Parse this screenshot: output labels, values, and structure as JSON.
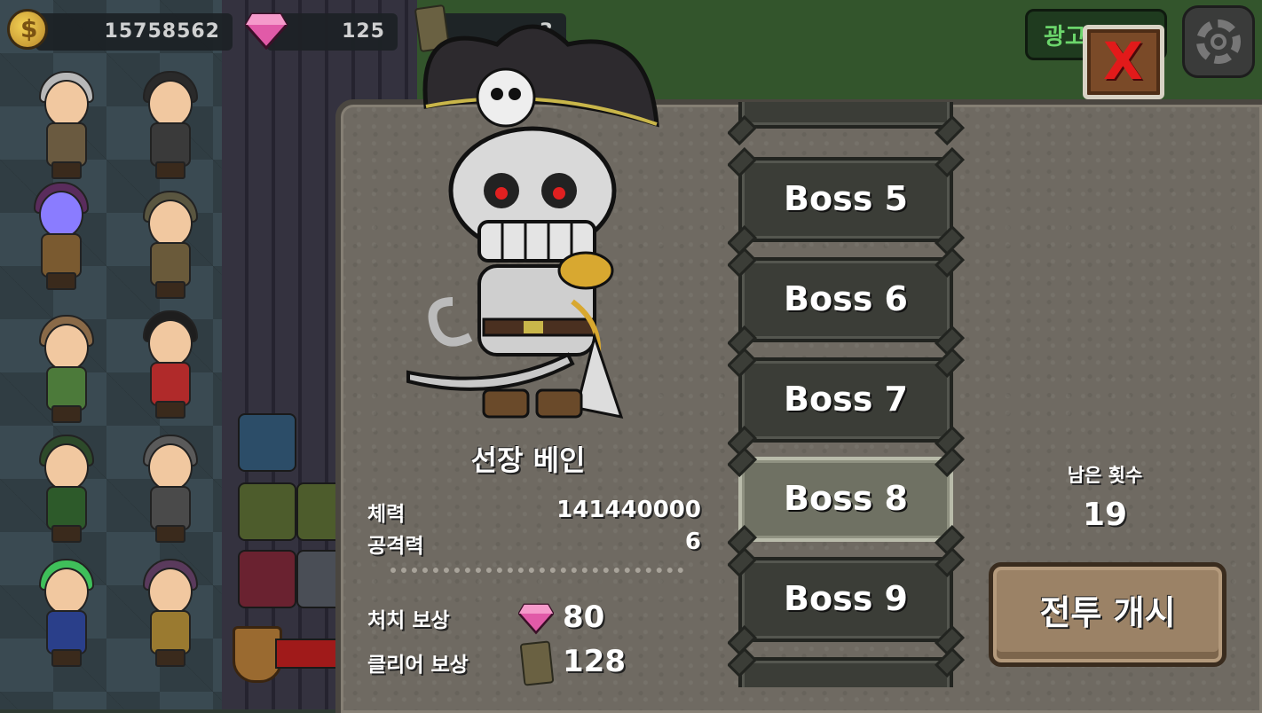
{
  "resources": {
    "gold": "15758562",
    "gems": "125",
    "tickets": "3"
  },
  "header": {
    "ad_label": "광고",
    "close_glyph": "X"
  },
  "boss": {
    "name": "선장 베인",
    "stats": [
      {
        "label": "체력",
        "value": "141440000"
      },
      {
        "label": "공격력",
        "value": "6"
      }
    ],
    "rewards": {
      "kill_label": "처치 보상",
      "kill_value": "80",
      "clear_label": "클리어 보상",
      "clear_value": "128"
    }
  },
  "boss_list": {
    "items": [
      {
        "label": "",
        "selected": false
      },
      {
        "label": "Boss 5",
        "selected": false
      },
      {
        "label": "Boss 6",
        "selected": false
      },
      {
        "label": "Boss 7",
        "selected": false
      },
      {
        "label": "Boss 8",
        "selected": true
      },
      {
        "label": "Boss 9",
        "selected": false
      },
      {
        "label": "",
        "selected": false
      }
    ]
  },
  "remaining": {
    "label": "남은 횟수",
    "value": "19"
  },
  "actions": {
    "start_battle": "전투 개시"
  },
  "colors": {
    "gem": "#e15aa8",
    "close_x": "#e21a1a",
    "ad_text": "#6bd56b",
    "selected_boss": "#6f7163"
  },
  "icons": [
    "coin-icon",
    "gem-icon",
    "ticket-icon",
    "gear-icon",
    "close-icon"
  ]
}
